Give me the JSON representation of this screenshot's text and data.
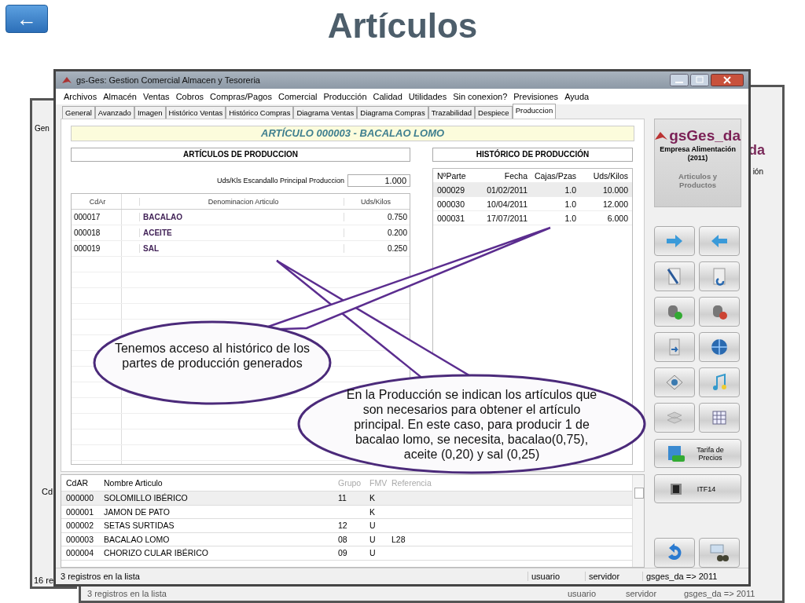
{
  "back_button": {
    "label": "←"
  },
  "title": "Artículos",
  "back_windows": {
    "left": {
      "tab": "Gen",
      "column": "Cd",
      "status": "16 re"
    },
    "right": {
      "logo": "da",
      "subtitle": "ión",
      "status": "3 registros en la lista",
      "user": "usuario",
      "server": "servidor",
      "db": "gsges_da => 2011"
    }
  },
  "window": {
    "title": "gs-Ges: Gestion Comercial Almacen y Tesoreria",
    "menu": [
      "Archivos",
      "Almacén",
      "Ventas",
      "Cobros",
      "Compras/Pagos",
      "Comercial",
      "Producción",
      "Calidad",
      "Utilidades",
      "Sin conexion?",
      "Previsiones",
      "Ayuda"
    ],
    "tabs": [
      {
        "label": "General",
        "selected": false
      },
      {
        "label": "Avanzado",
        "selected": false
      },
      {
        "label": "Imagen",
        "selected": false
      },
      {
        "label": "Histórico Ventas",
        "selected": false
      },
      {
        "label": "Histórico Compras",
        "selected": false
      },
      {
        "label": "Diagrama Ventas",
        "selected": false
      },
      {
        "label": "Diagrama Compras",
        "selected": false
      },
      {
        "label": "Trazabilidad",
        "selected": false
      },
      {
        "label": "Despiece",
        "selected": false
      },
      {
        "label": "Produccion",
        "selected": true
      }
    ],
    "article_header": "ARTÍCULO 000003 - BACALAO LOMO",
    "production": {
      "title": "ARTÍCULOS DE PRODUCCION",
      "quantity_label": "Uds/Kls Escandallo Principal Produccion",
      "quantity": "1.000",
      "columns": [
        "CdAr",
        "Denominacion Articulo",
        "Uds/Kilos"
      ],
      "rows": [
        {
          "code": "000017",
          "name": "BACALAO",
          "qty": "0.750"
        },
        {
          "code": "000018",
          "name": "ACEITE",
          "qty": "0.200"
        },
        {
          "code": "000019",
          "name": "SAL",
          "qty": "0.250"
        }
      ]
    },
    "history": {
      "title": "HISTÓRICO DE PRODUCCIÓN",
      "columns": [
        "NºParte",
        "Fecha",
        "Cajas/Pzas",
        "Uds/Kilos"
      ],
      "rows": [
        {
          "cells": [
            "000029",
            "01/02/2011",
            "1.0",
            "10.000"
          ],
          "selected": true
        },
        {
          "cells": [
            "000030",
            "10/04/2011",
            "1.0",
            "12.000"
          ],
          "selected": false
        },
        {
          "cells": [
            "000031",
            "17/07/2011",
            "1.0",
            "6.000"
          ],
          "selected": false
        }
      ]
    },
    "brand": {
      "name": "gsGes_da",
      "company": "Empresa Alimentación",
      "year": "(2011)",
      "module": "Articulos y Productos"
    },
    "price_button": "Tarifa de Precios",
    "itf_button": "ITF14",
    "list": {
      "columns": [
        "CdAR",
        "Nombre Articulo",
        "Grupo",
        "FMV",
        "Referencia"
      ],
      "rows": [
        {
          "cells": [
            "000000",
            "SOLOMILLO IBÉRICO",
            "11",
            "K",
            ""
          ],
          "selected": true
        },
        {
          "cells": [
            "000001",
            "JAMON DE PATO",
            "",
            "K",
            ""
          ],
          "selected": false
        },
        {
          "cells": [
            "000002",
            "SETAS SURTIDAS",
            "12",
            "U",
            ""
          ],
          "selected": false
        },
        {
          "cells": [
            "000003",
            "BACALAO LOMO",
            "08",
            "U",
            "L28"
          ],
          "selected": false
        },
        {
          "cells": [
            "000004",
            "CHORIZO CULAR IBÉRICO",
            "09",
            "U",
            ""
          ],
          "selected": false
        }
      ]
    },
    "status_bar": {
      "records": "3 registros en la lista",
      "user": "usuario",
      "server": "servidor",
      "db": "gsges_da => 2011"
    }
  },
  "callouts": [
    {
      "text": "Tenemos acceso al histórico de los partes de producción generados"
    },
    {
      "text": "En la Producción se indican los artículos que son necesarios para obtener el artículo principal. En este caso, para producir 1 de bacalao lomo, se necesita, bacalao(0,75), aceite (0,20) y sal (0,25)"
    }
  ]
}
